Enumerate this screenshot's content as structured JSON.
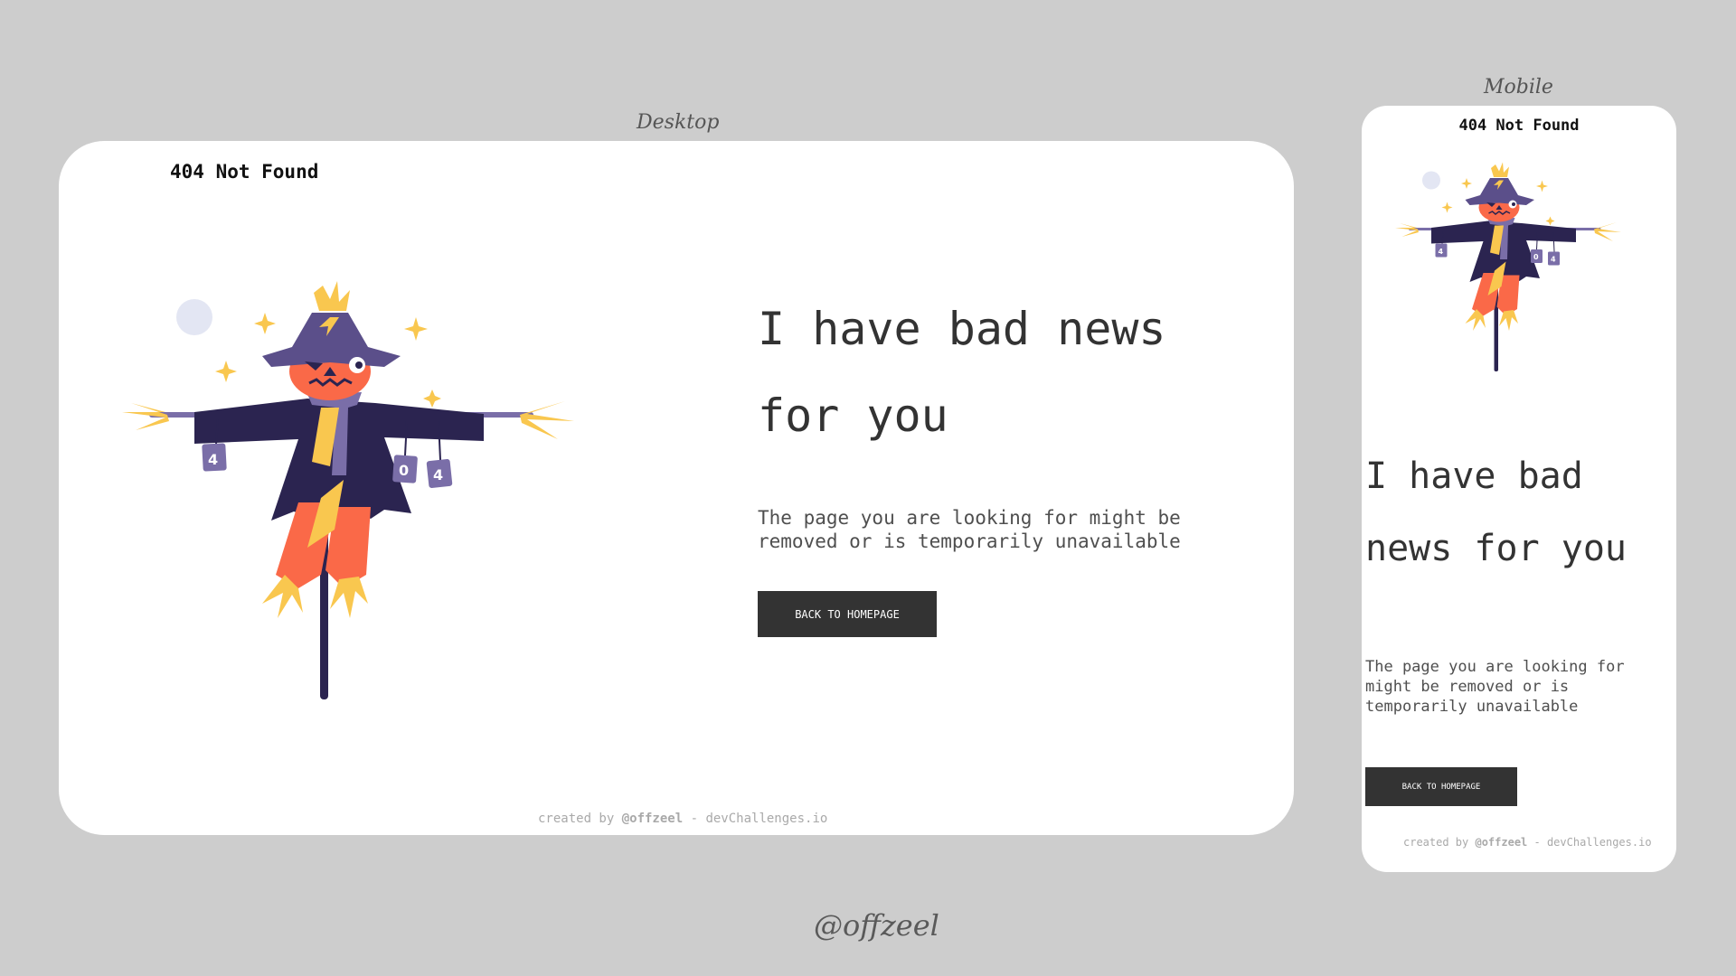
{
  "labels": {
    "desktop": "Desktop",
    "mobile": "Mobile",
    "signature": "@offzeel"
  },
  "page": {
    "brand": "404 Not Found",
    "headline_line1": "I have bad news",
    "headline_line2": "for you",
    "description": "The page you are looking for might be removed or is temporarily unavailable",
    "button_label": "BACK TO HOMEPAGE",
    "credit_prefix": "created by ",
    "credit_author": "@offzeel",
    "credit_suffix": " - devChallenges.io"
  },
  "mobile": {
    "headline_line1": "I have bad",
    "headline_line2": "news for you"
  },
  "illustration": {
    "name": "scarecrow",
    "can_labels": [
      "4",
      "0",
      "4"
    ]
  },
  "colors": {
    "background": "#cdcdcd",
    "card": "#ffffff",
    "text": "#333333",
    "button": "#333333",
    "coat": "#2b2450",
    "hat": "#5b4f8a",
    "face": "#fa6948",
    "straw": "#f9c74f",
    "scarf": "#7a6ea8",
    "pole": "#2b2450"
  }
}
